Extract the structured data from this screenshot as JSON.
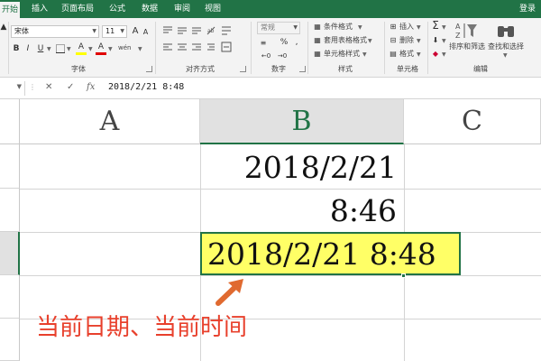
{
  "ribbon_tabs": [
    "开始",
    "插入",
    "页面布局",
    "公式",
    "数据",
    "审阅",
    "视图"
  ],
  "login": "登录",
  "clipboard": {
    "arrow": "▲"
  },
  "font": {
    "name": "宋体",
    "size": "11",
    "grow": "A",
    "shrink": "A",
    "bold": "B",
    "italic": "I",
    "underline": "U",
    "fill_letter": "A",
    "color_letter": "A",
    "phonetic": "wén",
    "group_label": "字体"
  },
  "alignment": {
    "group_label": "对齐方式"
  },
  "number": {
    "format": "常规",
    "percent": "%",
    "comma": ",",
    "group_label": "数字"
  },
  "styles": {
    "conditional": "条件格式",
    "table": "套用表格格式",
    "cell_styles": "单元格样式",
    "group_label": "样式"
  },
  "cells": {
    "insert": "插入",
    "delete": "删除",
    "format": "格式",
    "group_label": "单元格"
  },
  "editing": {
    "sum": "Σ",
    "sort_filter": "排序和筛选",
    "find_select": "查找和选择",
    "group_label": "编辑"
  },
  "formula_bar": {
    "cancel": "✕",
    "enter": "✓",
    "fx": "fx",
    "value": "2018/2/21  8:48"
  },
  "columns": [
    "A",
    "B",
    "C"
  ],
  "grid_cells": {
    "b1": "2018/2/21",
    "b2": "8:46",
    "b3": "2018/2/21  8:48"
  },
  "annotation": "当前日期、当前时间",
  "colors": {
    "excel_green": "#217346",
    "highlight": "#ffff66",
    "annotation": "#e8402c"
  }
}
